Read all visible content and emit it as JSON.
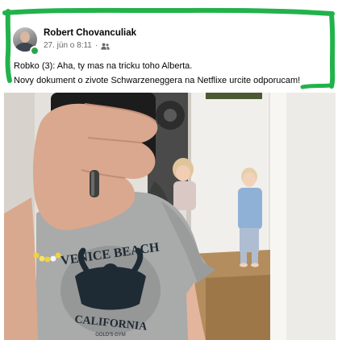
{
  "post": {
    "author": "Robert Chovanculiak",
    "timestamp": "27. jún o 8:11",
    "separator": "·",
    "audience_icon": "friends-icon",
    "lines": [
      "Robko (3): Aha, ty mas na tricku toho Alberta.",
      "Novy dokument o zivote Schwarzeneggera na Netflixe urcite odporucam!"
    ]
  },
  "photo": {
    "shirt_print": {
      "top": "VENICE BEACH",
      "bottom": "CALIFORNIA",
      "tiny": "GOLD'S GYM"
    }
  },
  "colors": {
    "highlight": "#22b24c",
    "online": "#31a24c"
  }
}
